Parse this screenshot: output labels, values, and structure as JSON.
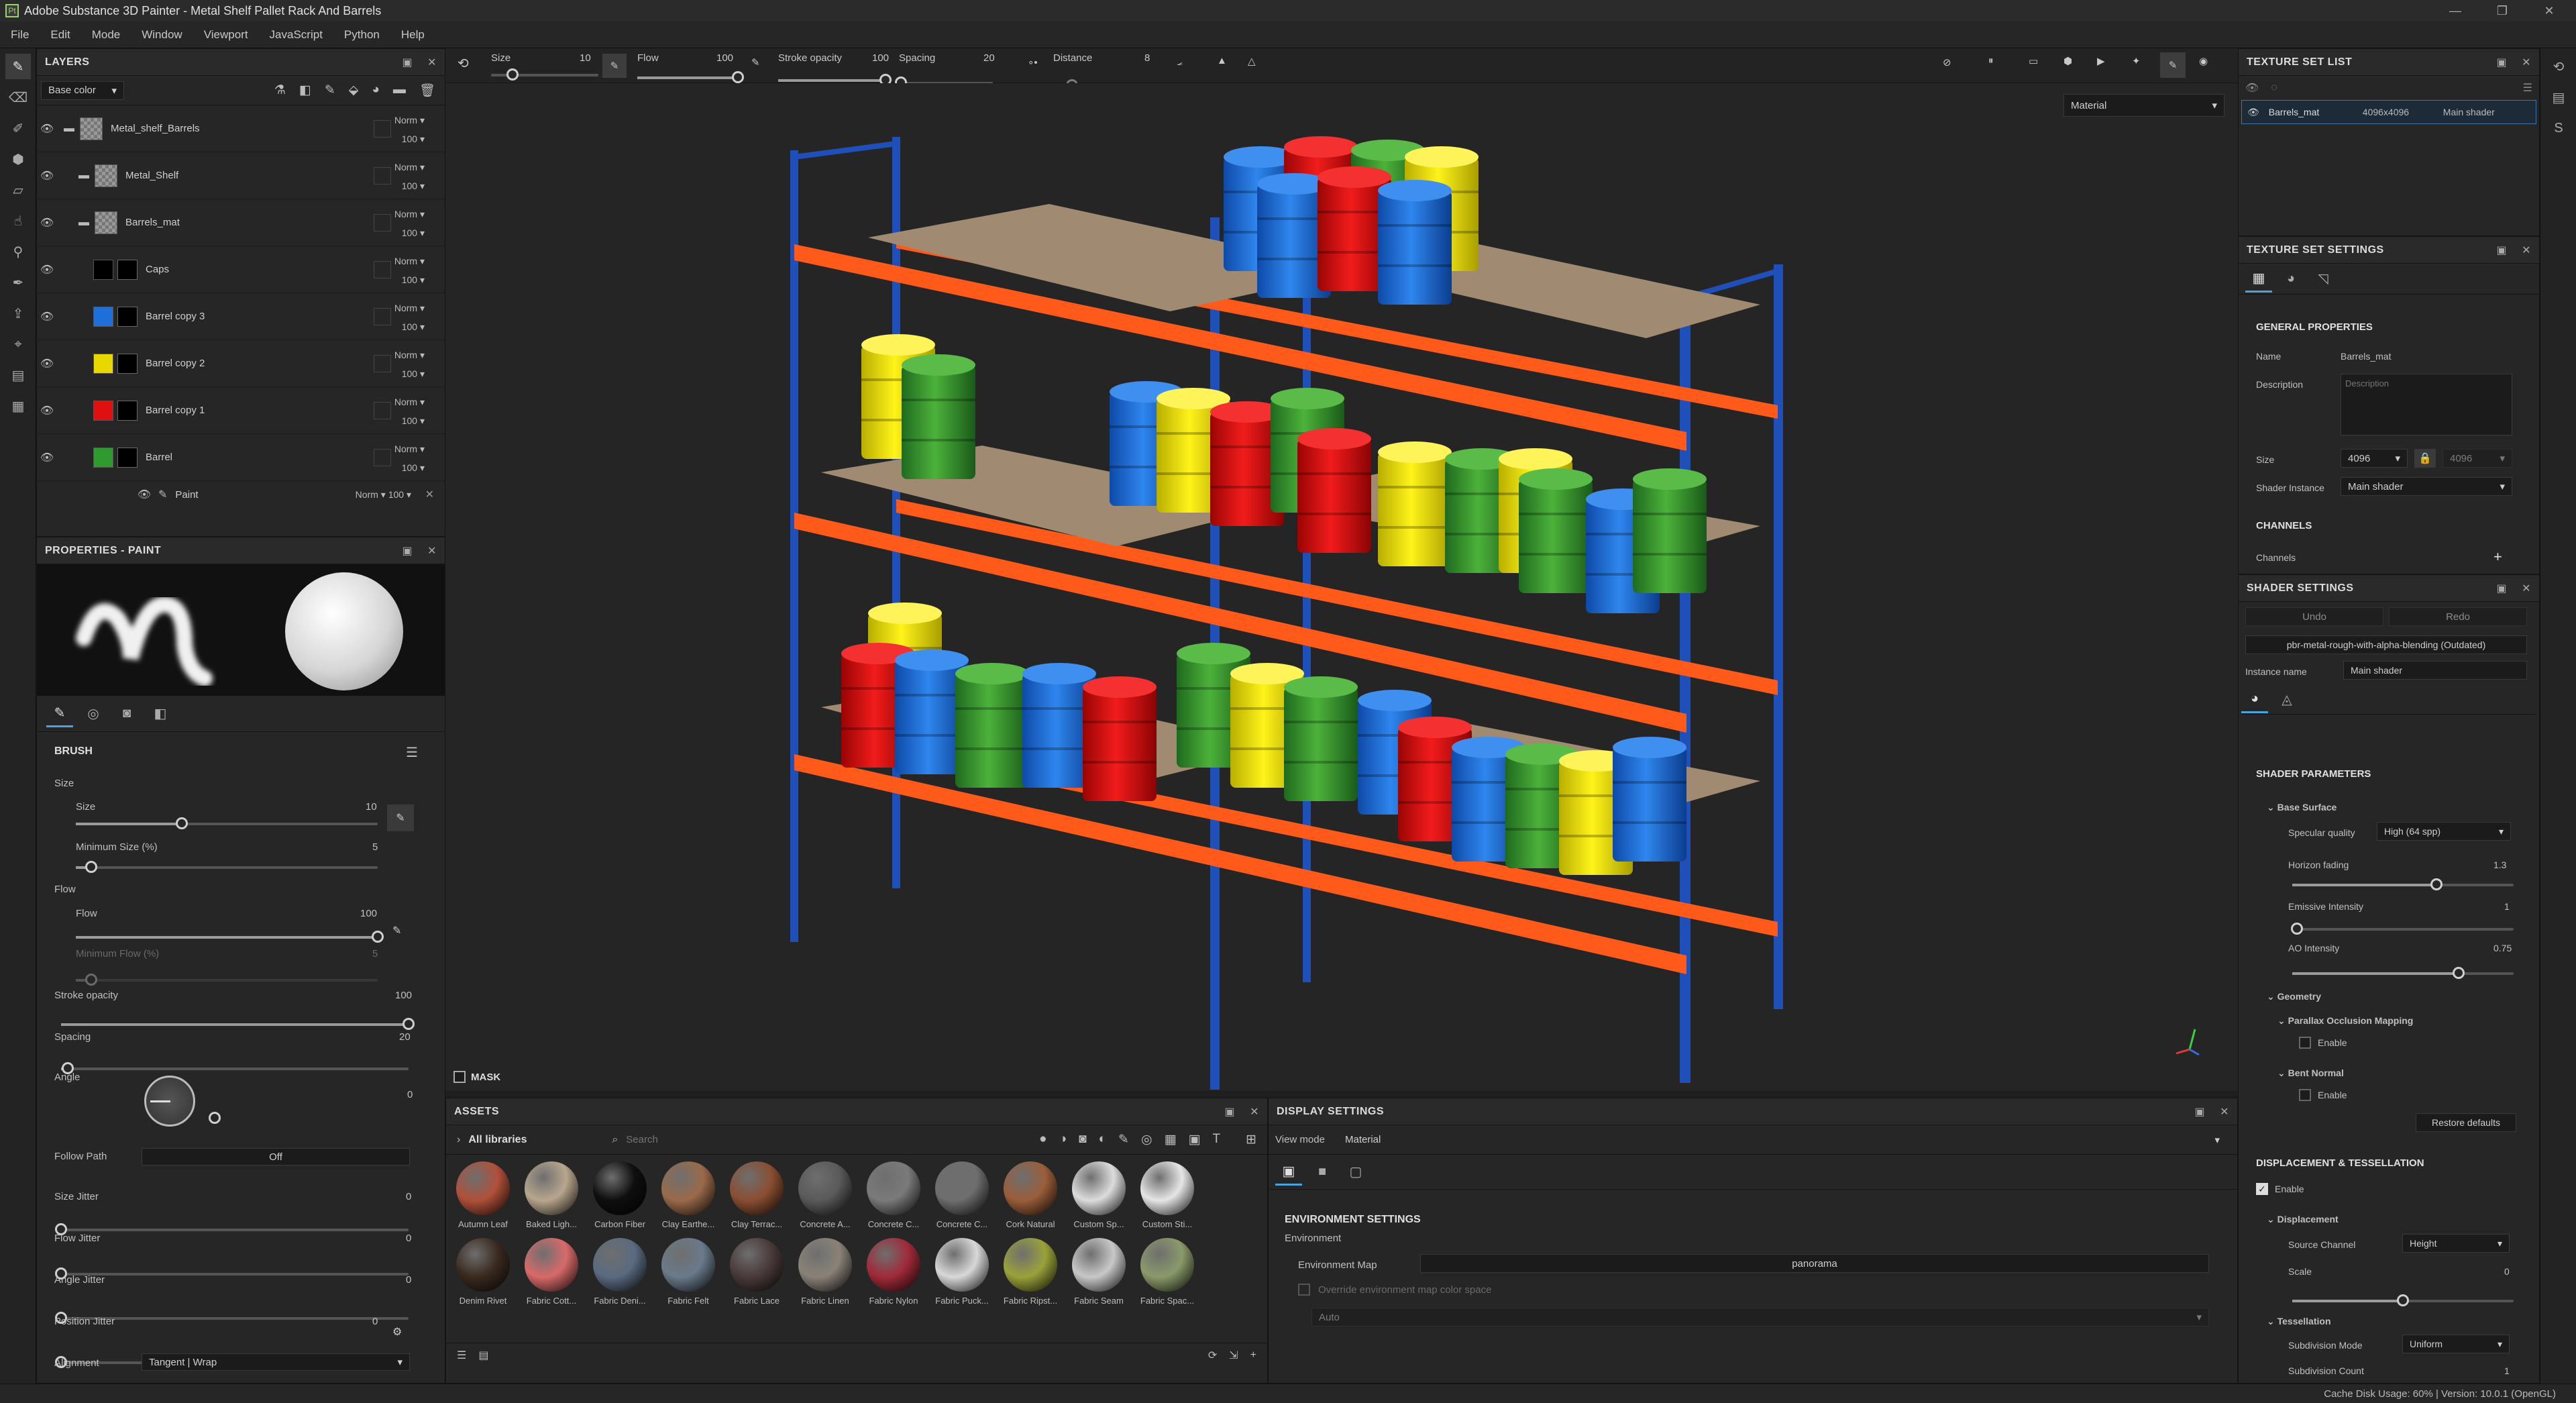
{
  "window": {
    "title": "Adobe Substance 3D Painter - Metal Shelf Pallet Rack And Barrels",
    "app_icon": "Pt"
  },
  "menu": [
    "File",
    "Edit",
    "Mode",
    "Window",
    "Viewport",
    "JavaScript",
    "Python",
    "Help"
  ],
  "toolbar": {
    "size_label": "Size",
    "size_value": "10",
    "flow_label": "Flow",
    "flow_value": "100",
    "stroke_opacity_label": "Stroke opacity",
    "stroke_opacity_value": "100",
    "spacing_label": "Spacing",
    "spacing_value": "20",
    "distance_label": "Distance",
    "distance_value": "8",
    "viewport_mode": "Material"
  },
  "layers": {
    "title": "LAYERS",
    "channel": "Base color",
    "items": [
      {
        "name": "Metal_shelf_Barrels",
        "blend": "Norm",
        "opacity": "100",
        "color": "#7a4a30"
      },
      {
        "name": "Metal_Shelf",
        "blend": "Norm",
        "opacity": "100",
        "color": "#8a8a8a"
      },
      {
        "name": "Barrels_mat",
        "blend": "Norm",
        "opacity": "100",
        "color": "#9a5a3a"
      },
      {
        "name": "Caps",
        "blend": "Norm",
        "opacity": "100",
        "color": "#000000"
      },
      {
        "name": "Barrel copy 3",
        "blend": "Norm",
        "opacity": "100",
        "color": "#1f6fd8"
      },
      {
        "name": "Barrel copy 2",
        "blend": "Norm",
        "opacity": "100",
        "color": "#e8d800"
      },
      {
        "name": "Barrel copy 1",
        "blend": "Norm",
        "opacity": "100",
        "color": "#e01010"
      },
      {
        "name": "Barrel",
        "blend": "Norm",
        "opacity": "100",
        "color": "#2f9a2f"
      }
    ],
    "paint_row": {
      "name": "Paint",
      "blend": "Norm",
      "opacity": "100"
    }
  },
  "properties": {
    "title": "PROPERTIES - PAINT",
    "brush_title": "BRUSH",
    "size_group": "Size",
    "size_label": "Size",
    "size_value": "10",
    "size_pct": 0.35,
    "min_size_label": "Minimum Size (%)",
    "min_size_value": "5",
    "min_size_pct": 0.05,
    "flow_group": "Flow",
    "flow_label": "Flow",
    "flow_value": "100",
    "flow_pct": 1.0,
    "min_flow_label": "Minimum Flow (%)",
    "min_flow_value": "5",
    "min_flow_pct": 0.05,
    "stroke_opacity_label": "Stroke opacity",
    "stroke_opacity_value": "100",
    "stroke_opacity_pct": 1.0,
    "spacing_label": "Spacing",
    "spacing_value": "20",
    "spacing_pct": 0.02,
    "angle_label": "Angle",
    "angle_value": "0",
    "follow_path_label": "Follow Path",
    "follow_path_value": "Off",
    "size_jitter_label": "Size Jitter",
    "size_jitter_value": "0",
    "flow_jitter_label": "Flow Jitter",
    "flow_jitter_value": "0",
    "angle_jitter_label": "Angle Jitter",
    "angle_jitter_value": "0",
    "position_jitter_label": "Position Jitter",
    "position_jitter_value": "0",
    "alignment_label": "Alignment",
    "alignment_value": "Tangent | Wrap"
  },
  "viewport": {
    "mask_label": "MASK"
  },
  "assets": {
    "title": "ASSETS",
    "library": "All libraries",
    "search_placeholder": "Search",
    "row1": [
      {
        "name": "Autumn Leaf",
        "color": "#b0503a"
      },
      {
        "name": "Baked Ligh...",
        "color": "#b8a68e"
      },
      {
        "name": "Carbon Fiber",
        "color": "#0e0e0e"
      },
      {
        "name": "Clay Earthe...",
        "color": "#9a6a4a"
      },
      {
        "name": "Clay Terrac...",
        "color": "#8a4e32"
      },
      {
        "name": "Concrete A...",
        "color": "#5a5a5a"
      },
      {
        "name": "Concrete C...",
        "color": "#7a7a7a"
      },
      {
        "name": "Concrete C...",
        "color": "#6e6e6e"
      },
      {
        "name": "Cork Natural",
        "color": "#9a5e3a"
      },
      {
        "name": "Custom Sp...",
        "color": "#dcdcdc"
      },
      {
        "name": "Custom Sti...",
        "color": "#e6e6e6"
      }
    ],
    "row2": [
      {
        "name": "Denim Rivet",
        "color": "#3a2a20"
      },
      {
        "name": "Fabric Cott...",
        "color": "#d86a6a"
      },
      {
        "name": "Fabric Deni...",
        "color": "#5a6a80"
      },
      {
        "name": "Fabric Felt",
        "color": "#6a7a8a"
      },
      {
        "name": "Fabric Lace",
        "color": "#4a3a3a"
      },
      {
        "name": "Fabric Linen",
        "color": "#8a8278"
      },
      {
        "name": "Fabric Nylon",
        "color": "#a02a3a"
      },
      {
        "name": "Fabric Puck...",
        "color": "#d8d8d8"
      },
      {
        "name": "Fabric Ripst...",
        "color": "#9aa23a"
      },
      {
        "name": "Fabric Seam",
        "color": "#c8c8c8"
      },
      {
        "name": "Fabric Spac...",
        "color": "#8a9a6a"
      }
    ]
  },
  "display": {
    "title": "DISPLAY SETTINGS",
    "view_mode_label": "View mode",
    "view_mode_value": "Material",
    "env_settings": "ENVIRONMENT SETTINGS",
    "environment": "Environment",
    "env_map_label": "Environment Map",
    "env_map_value": "panorama",
    "override_label": "Override environment map color space",
    "auto_value": "Auto"
  },
  "texture_set_list": {
    "title": "TEXTURE SET LIST",
    "item_name": "Barrels_mat",
    "item_res": "4096x4096",
    "item_shader": "Main shader"
  },
  "texture_set_settings": {
    "title": "TEXTURE SET SETTINGS",
    "general": "GENERAL PROPERTIES",
    "name_label": "Name",
    "name_value": "Barrels_mat",
    "description_label": "Description",
    "description_placeholder": "Description",
    "size_label": "Size",
    "size_value": "4096",
    "size_value2": "4096",
    "shader_instance_label": "Shader Instance",
    "shader_instance_value": "Main shader",
    "channels_title": "CHANNELS",
    "channels_label": "Channels"
  },
  "shader_settings": {
    "title": "SHADER SETTINGS",
    "undo": "Undo",
    "redo": "Redo",
    "shader_name": "pbr-metal-rough-with-alpha-blending (Outdated)",
    "instance_label": "Instance name",
    "instance_value": "Main shader",
    "params_title": "SHADER PARAMETERS",
    "base_surface": "Base Surface",
    "specular_label": "Specular quality",
    "specular_value": "High (64 spp)",
    "horizon_label": "Horizon fading",
    "horizon_value": "1.3",
    "horizon_pct": 0.65,
    "emissive_label": "Emissive Intensity",
    "emissive_value": "1",
    "emissive_pct": 0.02,
    "ao_label": "AO Intensity",
    "ao_value": "0.75",
    "ao_pct": 0.75,
    "geometry": "Geometry",
    "pom": "Parallax Occlusion Mapping",
    "pom_enable": "Enable",
    "bent_normal": "Bent Normal",
    "bent_enable": "Enable",
    "restore": "Restore defaults",
    "disp_title": "DISPLACEMENT & TESSELLATION",
    "disp_enable": "Enable",
    "displacement": "Displacement",
    "source_label": "Source Channel",
    "source_value": "Height",
    "scale_label": "Scale",
    "scale_value": "0",
    "scale_pct": 0.5,
    "tessellation": "Tessellation",
    "subdiv_mode_label": "Subdivision Mode",
    "subdiv_mode_value": "Uniform",
    "subdiv_count_label": "Subdivision Count",
    "subdiv_count_value": "1"
  },
  "status": {
    "text": "Cache Disk Usage:   60% | Version: 10.0.1 (OpenGL)"
  }
}
